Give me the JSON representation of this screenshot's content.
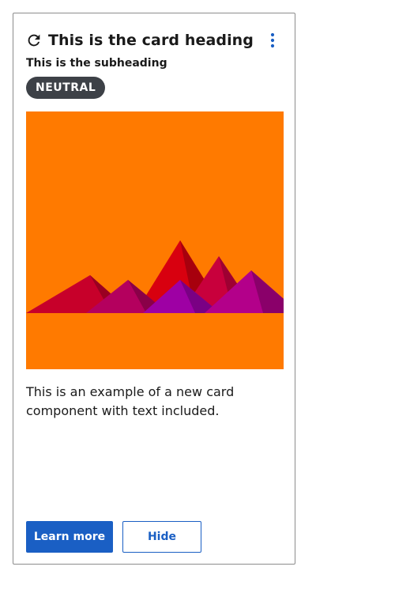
{
  "card": {
    "heading": "This is the card heading",
    "subheading": "This is the subheading",
    "badge": "NEUTRAL",
    "body": "This is an example of a new card component with text included.",
    "actions": {
      "primary_label": "Learn more",
      "secondary_label": "Hide"
    },
    "icons": {
      "refresh": "refresh-icon",
      "menu": "kebab-menu-icon"
    }
  },
  "colors": {
    "primary": "#1a5fc4",
    "badge_background": "#3d4147",
    "image_background": "#ff7a00"
  }
}
